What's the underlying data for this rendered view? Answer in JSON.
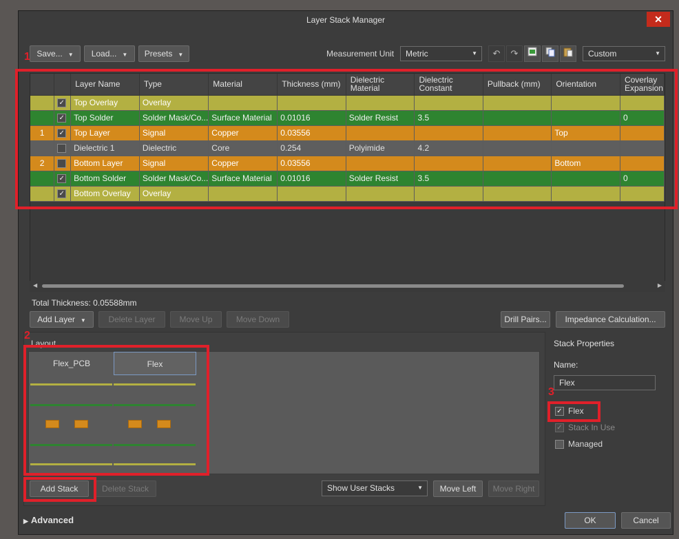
{
  "window": {
    "title": "Layer Stack Manager",
    "close_glyph": "✕"
  },
  "toolbar": {
    "save_label": "Save...",
    "load_label": "Load...",
    "presets_label": "Presets",
    "measurement_label": "Measurement Unit",
    "measurement_value": "Metric",
    "custom_value": "Custom",
    "icons": [
      "undo-icon",
      "redo-icon",
      "export-icon",
      "copy-icon",
      "paste-icon"
    ]
  },
  "grid": {
    "columns": [
      "",
      "",
      "Layer Name",
      "Type",
      "Material",
      "Thickness (mm)",
      "Dielectric Material",
      "Dielectric Constant",
      "Pullback (mm)",
      "Orientation",
      "Coverlay Expansion"
    ],
    "rows": [
      {
        "kind": "overlay",
        "num": "",
        "checked": true,
        "name": "Top Overlay",
        "type": "Overlay",
        "material": "",
        "thickness": "",
        "dmat": "",
        "dconst": "",
        "pullback": "",
        "orientation": "",
        "coverlay": ""
      },
      {
        "kind": "solder",
        "num": "",
        "checked": true,
        "name": "Top Solder",
        "type": "Solder Mask/Co...",
        "material": "Surface Material",
        "thickness": "0.01016",
        "dmat": "Solder Resist",
        "dconst": "3.5",
        "pullback": "",
        "orientation": "",
        "coverlay": "0"
      },
      {
        "kind": "signal",
        "num": "1",
        "checked": true,
        "name": "Top Layer",
        "type": "Signal",
        "material": "Copper",
        "thickness": "0.03556",
        "dmat": "",
        "dconst": "",
        "pullback": "",
        "orientation": "Top",
        "coverlay": ""
      },
      {
        "kind": "dielectric",
        "num": "",
        "checked": false,
        "name": "Dielectric 1",
        "type": "Dielectric",
        "material": "Core",
        "thickness": "0.254",
        "dmat": "Polyimide",
        "dconst": "4.2",
        "pullback": "",
        "orientation": "",
        "coverlay": ""
      },
      {
        "kind": "signal",
        "num": "2",
        "checked": false,
        "name": "Bottom Layer",
        "type": "Signal",
        "material": "Copper",
        "thickness": "0.03556",
        "dmat": "",
        "dconst": "",
        "pullback": "",
        "orientation": "Bottom",
        "coverlay": ""
      },
      {
        "kind": "solder",
        "num": "",
        "checked": true,
        "name": "Bottom Solder",
        "type": "Solder Mask/Co...",
        "material": "Surface Material",
        "thickness": "0.01016",
        "dmat": "Solder Resist",
        "dconst": "3.5",
        "pullback": "",
        "orientation": "",
        "coverlay": "0"
      },
      {
        "kind": "overlay",
        "num": "",
        "checked": true,
        "name": "Bottom Overlay",
        "type": "Overlay",
        "material": "",
        "thickness": "",
        "dmat": "",
        "dconst": "",
        "pullback": "",
        "orientation": "",
        "coverlay": ""
      }
    ]
  },
  "summary": {
    "total_thickness": "Total Thickness: 0.05588mm"
  },
  "layer_actions": {
    "add_layer": "Add Layer",
    "delete_layer": "Delete Layer",
    "move_up": "Move Up",
    "move_down": "Move Down",
    "drill_pairs": "Drill Pairs...",
    "impedance": "Impedance Calculation..."
  },
  "layout": {
    "heading": "Layout",
    "stacks": [
      "Flex_PCB",
      "Flex"
    ],
    "add_stack": "Add Stack",
    "delete_stack": "Delete Stack",
    "show_stacks": "Show User Stacks",
    "move_left": "Move Left",
    "move_right": "Move Right"
  },
  "stack_properties": {
    "heading": "Stack Properties",
    "name_label": "Name:",
    "name_value": "Flex",
    "flex_label": "Flex",
    "flex_checked": true,
    "in_use_label": "Stack In Use",
    "in_use_checked": true,
    "managed_label": "Managed",
    "managed_checked": false
  },
  "footer": {
    "advanced": "Advanced",
    "ok": "OK",
    "cancel": "Cancel"
  },
  "annotations": [
    "1",
    "2",
    "3"
  ],
  "colors": {
    "overlay": "#b3b042",
    "solder": "#2e8430",
    "signal": "#d48a1c",
    "dielectric": "#5e5e5e",
    "highlight": "#e0202a"
  }
}
